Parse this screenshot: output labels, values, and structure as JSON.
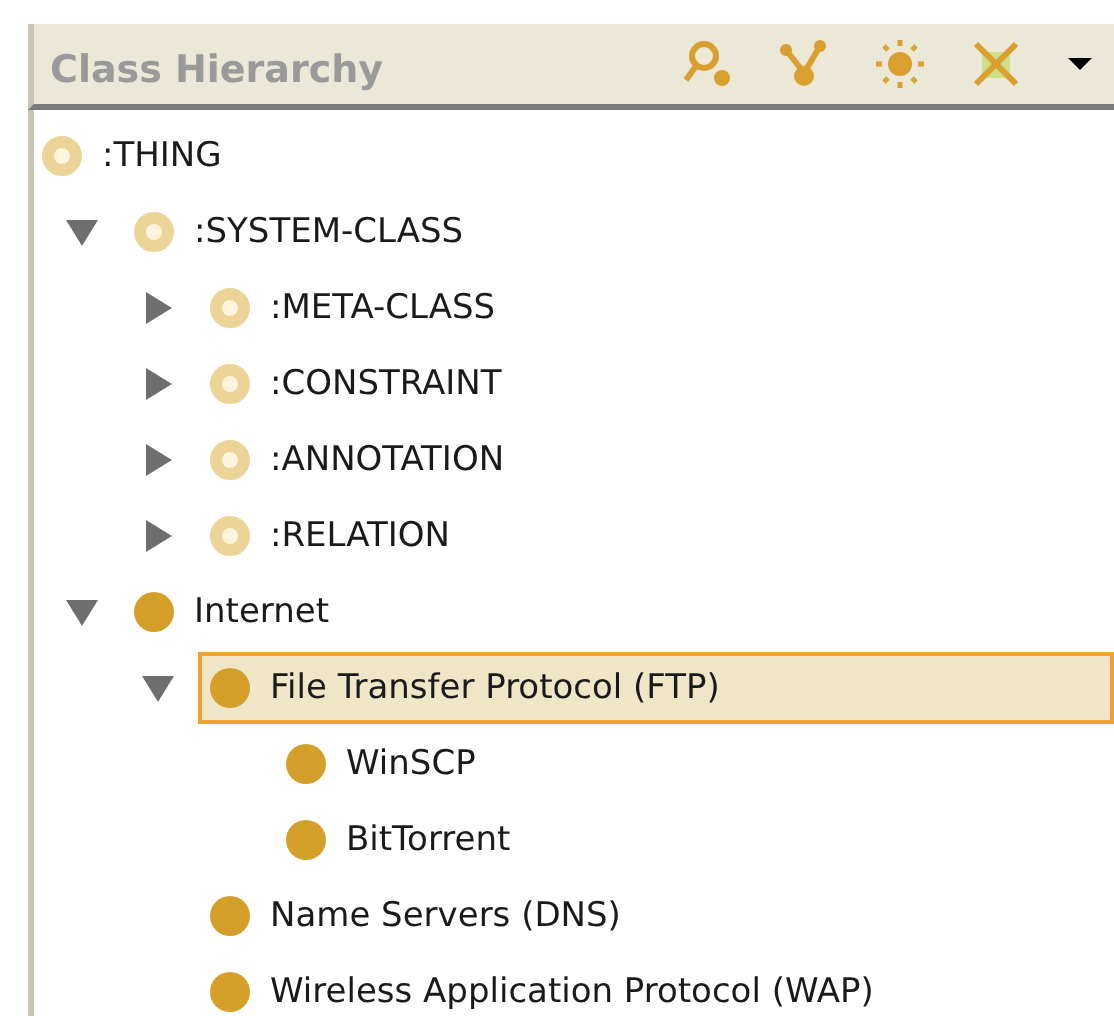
{
  "panel": {
    "title": "Class Hierarchy"
  },
  "tree": {
    "label": ":THING",
    "kind": "system",
    "children": [
      {
        "label": ":SYSTEM-CLASS",
        "kind": "system",
        "expanded": true,
        "selected": false,
        "children": [
          {
            "label": ":META-CLASS",
            "kind": "system",
            "expanded": false,
            "selected": false
          },
          {
            "label": ":CONSTRAINT",
            "kind": "system",
            "expanded": false,
            "selected": false
          },
          {
            "label": ":ANNOTATION",
            "kind": "system",
            "expanded": false,
            "selected": false
          },
          {
            "label": ":RELATION",
            "kind": "system",
            "expanded": false,
            "selected": false
          }
        ]
      },
      {
        "label": "Internet",
        "kind": "user",
        "expanded": true,
        "selected": false,
        "children": [
          {
            "label": "File Transfer Protocol (FTP)",
            "kind": "user",
            "expanded": true,
            "selected": true,
            "children": [
              {
                "label": "WinSCP",
                "kind": "user",
                "selected": false
              },
              {
                "label": "BitTorrent",
                "kind": "user",
                "selected": false
              }
            ]
          },
          {
            "label": "Name Servers (DNS)",
            "kind": "user",
            "selected": false
          },
          {
            "label": "Wireless Application Protocol (WAP)",
            "kind": "user",
            "selected": false
          }
        ]
      }
    ]
  }
}
